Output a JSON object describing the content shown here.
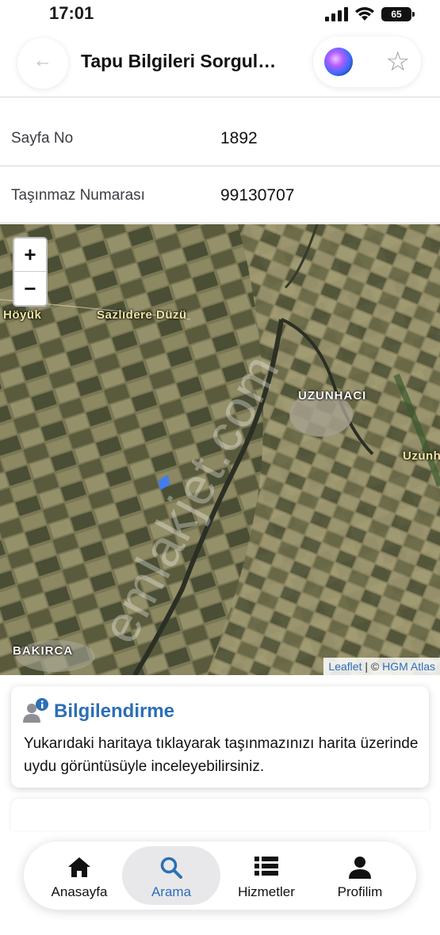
{
  "status_bar": {
    "time": "17:01",
    "battery": "65"
  },
  "nav": {
    "title": "Tapu Bilgileri Sorgul…",
    "back_icon": "back-arrow-icon",
    "siri_icon": "siri-icon",
    "favorite_icon": "star-icon"
  },
  "rows": [
    {
      "label": "Sayfa No",
      "value": "1892"
    },
    {
      "label": "Taşınmaz Numarası",
      "value": "99130707"
    }
  ],
  "map": {
    "zoom_in": "+",
    "zoom_out": "−",
    "places": {
      "hoyuk": "Höyük",
      "sazlidere": "Sazlıdere Düzü",
      "uzunhaci": "UZUNHACI",
      "uzunh": "Uzunh",
      "bakirca": "BAKIRCA"
    },
    "attribution": {
      "leaflet": "Leaflet",
      "separator": " | © ",
      "provider": "HGM Atlas"
    },
    "watermark": "emlakjet.com",
    "parcel_color": "#3a7bff"
  },
  "info_card": {
    "title": "Bilgilendirme",
    "text": "Yukarıdaki haritaya tıklayarak taşınmazınızı harita üzerinde uydu görüntüsüyle inceleyebilirsiniz.",
    "title_color": "#2c6fb6"
  },
  "tabs": [
    {
      "label": "Anasayfa",
      "icon": "home-icon",
      "active": false
    },
    {
      "label": "Arama",
      "icon": "search-icon",
      "active": true
    },
    {
      "label": "Hizmetler",
      "icon": "list-icon",
      "active": false
    },
    {
      "label": "Profilim",
      "icon": "person-icon",
      "active": false
    }
  ]
}
